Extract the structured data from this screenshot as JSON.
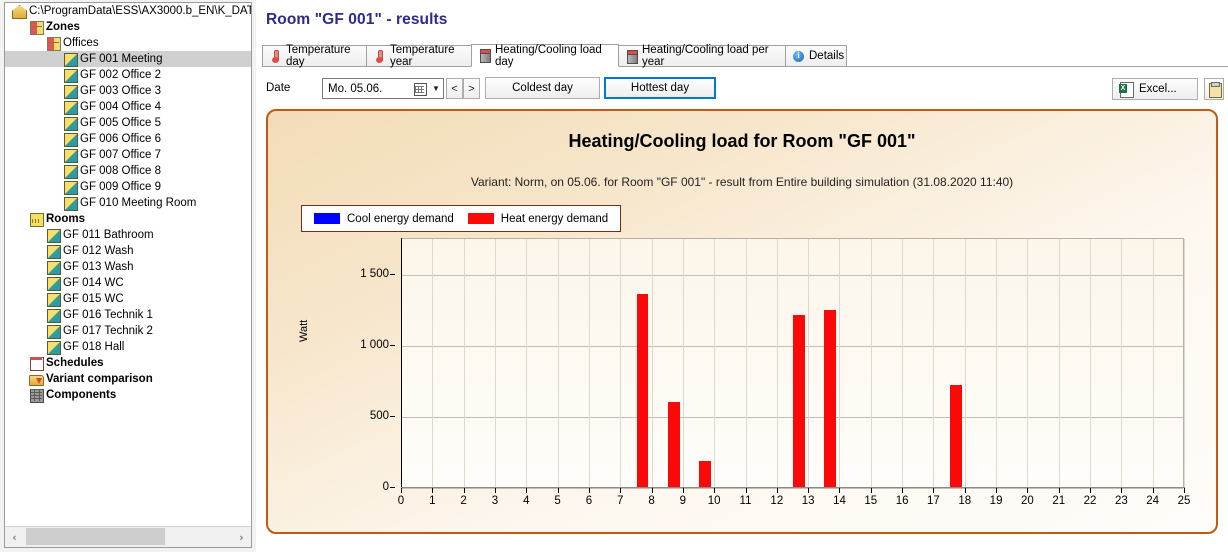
{
  "tree": {
    "root": "C:\\ProgramData\\ESS\\AX3000.b_EN\\K_DAT",
    "items": [
      {
        "label": "C:\\ProgramData\\ESS\\AX3000.b_EN\\K_DAT",
        "icon": "home-icon",
        "depth": 0,
        "bold": false,
        "selected": false
      },
      {
        "label": "Zones",
        "icon": "zone-icon",
        "depth": 1,
        "bold": true,
        "selected": false
      },
      {
        "label": "Offices",
        "icon": "zone-icon",
        "depth": 2,
        "bold": false,
        "selected": false
      },
      {
        "label": "GF 001 Meeting",
        "icon": "room-icon",
        "depth": 3,
        "bold": false,
        "selected": true
      },
      {
        "label": "GF 002 Office 2",
        "icon": "room-icon",
        "depth": 3,
        "bold": false,
        "selected": false
      },
      {
        "label": "GF 003 Office 3",
        "icon": "room-icon",
        "depth": 3,
        "bold": false,
        "selected": false
      },
      {
        "label": "GF 004 Office 4",
        "icon": "room-icon",
        "depth": 3,
        "bold": false,
        "selected": false
      },
      {
        "label": "GF 005 Office 5",
        "icon": "room-icon",
        "depth": 3,
        "bold": false,
        "selected": false
      },
      {
        "label": "GF 006 Office 6",
        "icon": "room-icon",
        "depth": 3,
        "bold": false,
        "selected": false
      },
      {
        "label": "GF 007 Office 7",
        "icon": "room-icon",
        "depth": 3,
        "bold": false,
        "selected": false
      },
      {
        "label": "GF 008 Office 8",
        "icon": "room-icon",
        "depth": 3,
        "bold": false,
        "selected": false
      },
      {
        "label": "GF 009 Office 9",
        "icon": "room-icon",
        "depth": 3,
        "bold": false,
        "selected": false
      },
      {
        "label": "GF 010 Meeting Room",
        "icon": "room-icon",
        "depth": 3,
        "bold": false,
        "selected": false
      },
      {
        "label": "Rooms",
        "icon": "rooms-icon",
        "depth": 1,
        "bold": true,
        "selected": false
      },
      {
        "label": "GF 011 Bathroom",
        "icon": "room-icon",
        "depth": 2,
        "bold": false,
        "selected": false
      },
      {
        "label": "GF 012 Wash",
        "icon": "room-icon",
        "depth": 2,
        "bold": false,
        "selected": false
      },
      {
        "label": "GF 013 Wash",
        "icon": "room-icon",
        "depth": 2,
        "bold": false,
        "selected": false
      },
      {
        "label": "GF 014 WC",
        "icon": "room-icon",
        "depth": 2,
        "bold": false,
        "selected": false
      },
      {
        "label": "GF 015 WC",
        "icon": "room-icon",
        "depth": 2,
        "bold": false,
        "selected": false
      },
      {
        "label": "GF 016 Technik 1",
        "icon": "room-icon",
        "depth": 2,
        "bold": false,
        "selected": false
      },
      {
        "label": "GF 017 Technik 2",
        "icon": "room-icon",
        "depth": 2,
        "bold": false,
        "selected": false
      },
      {
        "label": "GF 018 Hall",
        "icon": "room-icon",
        "depth": 2,
        "bold": false,
        "selected": false
      },
      {
        "label": "Schedules",
        "icon": "schedules-icon",
        "depth": 1,
        "bold": true,
        "selected": false
      },
      {
        "label": "Variant comparison",
        "icon": "variant-icon",
        "depth": 1,
        "bold": true,
        "selected": false
      },
      {
        "label": "Components",
        "icon": "components-icon",
        "depth": 1,
        "bold": true,
        "selected": false
      }
    ],
    "scrollbar": {
      "left_arrow": "‹",
      "right_arrow": "›"
    }
  },
  "header": {
    "title": "Room \"GF 001\" - results"
  },
  "tabs": [
    {
      "label": "Temperature day",
      "icon": "thermometer-icon",
      "active": false
    },
    {
      "label": "Temperature year",
      "icon": "thermometer-icon",
      "active": false
    },
    {
      "label": "Heating/Cooling load day",
      "icon": "load-icon",
      "active": true
    },
    {
      "label": "Heating/Cooling load per year",
      "icon": "load-icon",
      "active": false
    },
    {
      "label": "Details",
      "icon": "info-icon",
      "active": false
    }
  ],
  "toolbar": {
    "date_label": "Date",
    "date_value": "Mo. 05.06.",
    "prev_label": "<",
    "next_label": ">",
    "coldest_label": "Coldest day",
    "hottest_label": "Hottest day",
    "excel_label": "Excel...",
    "clipboard_icon": "clipboard-icon",
    "accent_color": "#0078d7"
  },
  "chart_data": {
    "type": "bar",
    "title": "Heating/Cooling load for Room \"GF 001\"",
    "subtitle": "Variant: Norm, on 05.06. for Room \"GF 001\" - result from Entire building simulation (31.08.2020 11:40)",
    "xlabel": "",
    "ylabel": "Watt",
    "xlim": [
      0,
      25
    ],
    "ylim": [
      0,
      1750
    ],
    "yticks": [
      0,
      500,
      1000,
      1500
    ],
    "ytick_labels": [
      "0",
      "500",
      "1 000",
      "1 500"
    ],
    "xticks": [
      0,
      1,
      2,
      3,
      4,
      5,
      6,
      7,
      8,
      9,
      10,
      11,
      12,
      13,
      14,
      15,
      16,
      17,
      18,
      19,
      20,
      21,
      22,
      23,
      24,
      25
    ],
    "xtick_labels": [
      "0",
      "1",
      "2",
      "3",
      "4",
      "5",
      "6",
      "7",
      "8",
      "9",
      "10",
      "11",
      "12",
      "13",
      "14",
      "15",
      "16",
      "17",
      "18",
      "19",
      "20",
      "21",
      "22",
      "23",
      "24",
      "25"
    ],
    "grid": true,
    "legend_position": "top-left",
    "legend": [
      {
        "name": "Cool energy demand",
        "color": "#0000ff"
      },
      {
        "name": "Heat energy demand",
        "color": "#fb0808"
      }
    ],
    "series": [
      {
        "name": "Cool energy demand",
        "color": "#0000ff",
        "values": [
          0,
          0,
          0,
          0,
          0,
          0,
          0,
          0,
          0,
          0,
          0,
          0,
          0,
          0,
          0,
          0,
          0,
          0,
          0,
          0,
          0,
          0,
          0,
          0,
          0
        ]
      },
      {
        "name": "Heat energy demand",
        "color": "#fb0808",
        "values": [
          0,
          0,
          0,
          0,
          0,
          0,
          0,
          1355,
          600,
          180,
          0,
          0,
          1210,
          1245,
          0,
          0,
          0,
          720,
          0,
          0,
          0,
          0,
          0,
          0,
          0
        ]
      }
    ],
    "bar_hours": [
      8,
      9,
      10,
      13,
      14,
      18
    ],
    "bar_values": [
      1355,
      600,
      180,
      1210,
      1245,
      720
    ]
  },
  "panel": {
    "border_color": "#c05a14"
  }
}
